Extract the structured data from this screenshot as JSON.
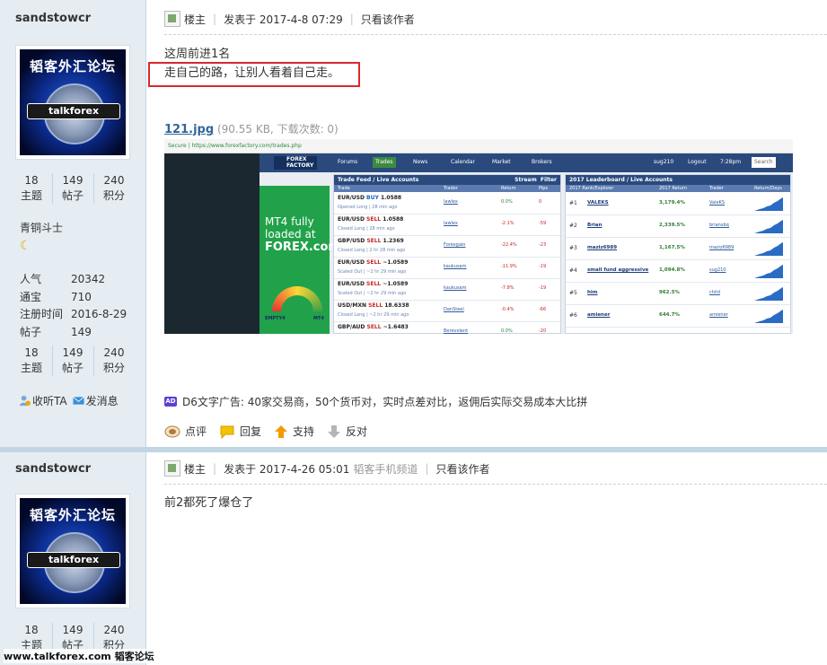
{
  "posts": [
    {
      "user": {
        "name": "sandstowcr",
        "avatar_text": "韬客外汇论坛",
        "avatar_brand": "talkforex",
        "stats_top": [
          {
            "value": "18",
            "label": "主题"
          },
          {
            "value": "149",
            "label": "帖子"
          },
          {
            "value": "240",
            "label": "积分"
          }
        ],
        "rank": "青铜斗士",
        "info": [
          {
            "key": "人气",
            "value": "20342"
          },
          {
            "key": "通宝",
            "value": "710"
          },
          {
            "key": "注册时间",
            "value": "2016-8-29"
          },
          {
            "key": "帖子",
            "value": "149"
          }
        ],
        "stats_bottom": [
          {
            "value": "18",
            "label": "主题"
          },
          {
            "value": "149",
            "label": "帖子"
          },
          {
            "value": "240",
            "label": "积分"
          }
        ],
        "follow_label": "收听TA",
        "message_label": "发消息"
      },
      "header": {
        "role": "楼主",
        "posted": "发表于 2017-4-8 07:29",
        "only_author": "只看该作者"
      },
      "content_lines": [
        "这周前进1名",
        "走自己的路，让别人看着自己走。"
      ],
      "attachment": {
        "name": "121.jpg",
        "meta": "(90.55 KB, 下载次数: 0)"
      },
      "ad_text": "D6文字广告: 40家交易商，50个货币对，实时点差对比，返佣后实际交易成本大比拼",
      "ad_icon": "AD",
      "actions": [
        {
          "label": "点评",
          "icon": "comment-icon"
        },
        {
          "label": "回复",
          "icon": "reply-icon"
        },
        {
          "label": "支持",
          "icon": "thumb-up-arrow-icon"
        },
        {
          "label": "反对",
          "icon": "thumb-down-arrow-icon"
        }
      ]
    },
    {
      "user": {
        "name": "sandstowcr",
        "avatar_text": "韬客外汇论坛",
        "avatar_brand": "talkforex",
        "stats_top": [
          {
            "value": "18",
            "label": "主题"
          },
          {
            "value": "149",
            "label": "帖子"
          },
          {
            "value": "240",
            "label": "积分"
          }
        ]
      },
      "header": {
        "role": "楼主",
        "posted": "发表于 2017-4-26 05:01",
        "channel": "韬客手机频道",
        "only_author": "只看该作者"
      },
      "content_lines": [
        "前2都死了爆仓了"
      ]
    }
  ],
  "screenshot": {
    "url_bar": "Secure | https://www.forexfactory.com/trades.php",
    "logo": "FOREX FACTORY",
    "nav": [
      "Forums",
      "Trades",
      "News",
      "Calendar",
      "Market",
      "Brokers"
    ],
    "user_label": "sug210",
    "logout": "Logout",
    "clock": "7:28pm",
    "search": "Search",
    "promo_lines": [
      "MT4 fully",
      "loaded at"
    ],
    "promo_brand": "FOREX.com",
    "gauge_left": "EMPTY4",
    "gauge_right": "MT4",
    "trade_feed": {
      "title": "Trade Feed / Live Accounts",
      "stream": "Stream",
      "filter": "Filter",
      "cols": [
        "Trade",
        "Trader",
        "Return",
        "Pips"
      ],
      "rows": [
        {
          "pair": "EUR/USD",
          "dir": "BUY",
          "price": "1.0588",
          "sub": "Opened Long | 28 min ago",
          "trader": "lawlex",
          "ret": "0.0%",
          "pips": "0"
        },
        {
          "pair": "EUR/USD",
          "dir": "SELL",
          "price": "1.0588",
          "sub": "Closed Long | 28 min ago",
          "trader": "lawlex",
          "ret": "-2.1%",
          "pips": "-59"
        },
        {
          "pair": "GBP/USD",
          "dir": "SELL",
          "price": "1.2369",
          "sub": "Closed Long | 2 hr 28 min ago",
          "trader": "Forexgain",
          "ret": "-22.4%",
          "pips": "-23"
        },
        {
          "pair": "EUR/USD",
          "dir": "SELL",
          "price": "~1.0589",
          "sub": "Scaled Out | ~2 hr 29 min ago",
          "trader": "kaukusam",
          "ret": "-11.9%",
          "pips": "-19"
        },
        {
          "pair": "EUR/USD",
          "dir": "SELL",
          "price": "~1.0589",
          "sub": "Scaled Out | ~2 hr 29 min ago",
          "trader": "kaukusam",
          "ret": "-7.8%",
          "pips": "-19"
        },
        {
          "pair": "USD/MXN",
          "dir": "SELL",
          "price": "18.6338",
          "sub": "Closed Long | ~2 hr 29 min ago",
          "trader": "DanSteel",
          "ret": "-0.4%",
          "pips": "-66"
        },
        {
          "pair": "GBP/AUD",
          "dir": "SELL",
          "price": "~1.6483",
          "sub": "",
          "trader": "Berevolent",
          "ret": "0.0%",
          "pips": "-20"
        }
      ]
    },
    "leaderboard": {
      "title": "2017 Leaderboard / Live Accounts",
      "cols": [
        "2017 Rank/Explorer",
        "2017 Return",
        "Trader",
        "Return/Days"
      ],
      "rows": [
        {
          "rank": "#1",
          "name": "VALEKS",
          "pct": "3,179.4%",
          "trader": "ValeKS"
        },
        {
          "rank": "#2",
          "name": "Brian",
          "pct": "2,339.5%",
          "trader": "briansbq"
        },
        {
          "rank": "#3",
          "name": "maziz6989",
          "pct": "1,167.5%",
          "trader": "maziz6989"
        },
        {
          "rank": "#4",
          "name": "small fund aggressive",
          "pct": "1,094.8%",
          "trader": "sug210"
        },
        {
          "rank": "#5",
          "name": "him",
          "pct": "962.5%",
          "trader": "child"
        },
        {
          "rank": "#6",
          "name": "amiener",
          "pct": "644.7%",
          "trader": "amiener"
        }
      ]
    }
  },
  "footer": "www.talkforex.com 韬客论坛"
}
